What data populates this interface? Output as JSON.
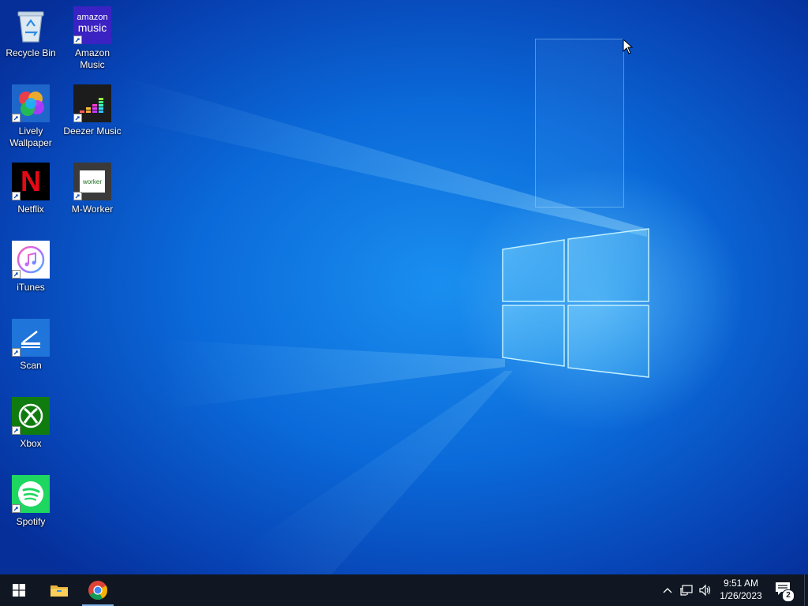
{
  "desktop": {
    "icons": [
      {
        "label": "Recycle Bin",
        "icon": "recycle-bin-icon"
      },
      {
        "label": "Amazon Music",
        "icon": "amazon-music-icon",
        "logo_text_1": "amazon",
        "logo_text_2": "music"
      },
      {
        "label": "Lively Wallpaper",
        "icon": "lively-wallpaper-icon"
      },
      {
        "label": "Deezer Music",
        "icon": "deezer-icon"
      },
      {
        "label": "Netflix",
        "icon": "netflix-icon",
        "logo_text": "N"
      },
      {
        "label": "M-Worker",
        "icon": "m-worker-icon",
        "logo_text": "worker"
      },
      {
        "label": "iTunes",
        "icon": "itunes-icon"
      },
      {
        "label": "Scan",
        "icon": "scan-icon"
      },
      {
        "label": "Xbox",
        "icon": "xbox-icon"
      },
      {
        "label": "Spotify",
        "icon": "spotify-icon"
      }
    ]
  },
  "taskbar": {
    "start": "start-icon",
    "pinned": [
      "file-explorer-icon",
      "chrome-icon"
    ],
    "tray": [
      "chevron-up-icon",
      "network-icon",
      "volume-icon"
    ],
    "clock": {
      "time": "9:51 AM",
      "date": "1/26/2023"
    },
    "notifications": {
      "count": "2"
    }
  },
  "colors": {
    "taskbar": "#101722",
    "wallpaper_accent": "#1a8ff0",
    "active_indicator": "#7fb4ea"
  }
}
